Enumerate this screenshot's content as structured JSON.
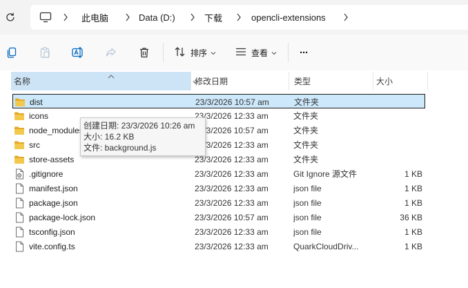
{
  "breadcrumb": {
    "items": [
      "此电脑",
      "Data (D:)",
      "下载",
      "opencli-extensions"
    ]
  },
  "toolbar": {
    "sort_label": "排序",
    "view_label": "查看",
    "more_label": "···"
  },
  "columns": {
    "name": "名称",
    "date": "修改日期",
    "type": "类型",
    "size": "大小"
  },
  "files": [
    {
      "name": "dist",
      "date": "23/3/2026 10:57 am",
      "type": "文件夹",
      "size": "",
      "kind": "folder",
      "selected": true
    },
    {
      "name": "icons",
      "date": "23/3/2026 12:33 am",
      "type": "文件夹",
      "size": "",
      "kind": "folder"
    },
    {
      "name": "node_modules",
      "date": "23/3/2026 10:57 am",
      "type": "文件夹",
      "size": "",
      "kind": "folder"
    },
    {
      "name": "src",
      "date": "23/3/2026 12:33 am",
      "type": "文件夹",
      "size": "",
      "kind": "folder"
    },
    {
      "name": "store-assets",
      "date": "23/3/2026 12:33 am",
      "type": "文件夹",
      "size": "",
      "kind": "folder"
    },
    {
      "name": ".gitignore",
      "date": "23/3/2026 12:33 am",
      "type": "Git Ignore 源文件",
      "size": "1 KB",
      "kind": "gear-file"
    },
    {
      "name": "manifest.json",
      "date": "23/3/2026 12:33 am",
      "type": "json file",
      "size": "1 KB",
      "kind": "file"
    },
    {
      "name": "package.json",
      "date": "23/3/2026 12:33 am",
      "type": "json file",
      "size": "1 KB",
      "kind": "file"
    },
    {
      "name": "package-lock.json",
      "date": "23/3/2026 10:57 am",
      "type": "json file",
      "size": "36 KB",
      "kind": "file"
    },
    {
      "name": "tsconfig.json",
      "date": "23/3/2026 12:33 am",
      "type": "json file",
      "size": "1 KB",
      "kind": "file"
    },
    {
      "name": "vite.config.ts",
      "date": "23/3/2026 12:33 am",
      "type": "QuarkCloudDriv...",
      "size": "1 KB",
      "kind": "file"
    }
  ],
  "tooltip": {
    "created": "创建日期: 23/3/2026 10:26 am",
    "size": "大小: 16.2 KB",
    "files": "文件: background.js"
  },
  "colors": {
    "folder": "#f2c94c",
    "folder_dark": "#e3a92a",
    "selection": "#cde8fb",
    "header_active": "#cde3f6",
    "accent": "#0067c0"
  }
}
